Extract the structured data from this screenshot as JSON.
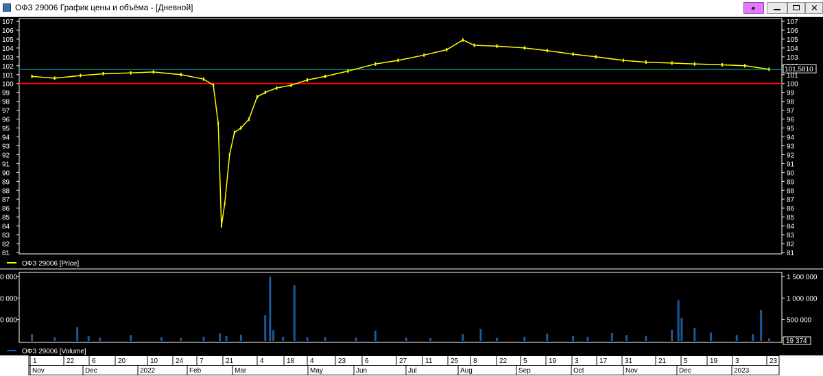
{
  "window": {
    "title": "ОФЗ 29006 График цены и объёма - [Дневной]"
  },
  "colors": {
    "price": "#ffff00",
    "volume": "#1a5a9a",
    "reference_line": "#ff0000",
    "last_price_line": "#00a0a0",
    "background": "#000000",
    "axis_text": "#ffffff"
  },
  "price_panel": {
    "legend": "ОФЗ 29006 [Price]",
    "last_value_label": "101,5810"
  },
  "volume_panel": {
    "legend": "ОФЗ 29006 [Volume]",
    "last_value_label": "19 374"
  },
  "chart_data": [
    {
      "type": "line",
      "title": "",
      "series": [
        {
          "name": "ОФЗ 29006 [Price]",
          "x": [
            "2021-11-01",
            "2021-11-15",
            "2021-12-01",
            "2021-12-15",
            "2022-01-01",
            "2022-01-15",
            "2022-02-01",
            "2022-02-15",
            "2022-02-21",
            "2022-02-24",
            "2022-02-26",
            "2022-02-28",
            "2022-03-03",
            "2022-03-06",
            "2022-03-10",
            "2022-03-15",
            "2022-03-20",
            "2022-03-25",
            "2022-04-01",
            "2022-04-10",
            "2022-04-20",
            "2022-05-01",
            "2022-05-15",
            "2022-06-01",
            "2022-06-15",
            "2022-07-01",
            "2022-07-15",
            "2022-07-25",
            "2022-08-01",
            "2022-08-15",
            "2022-09-01",
            "2022-09-15",
            "2022-10-01",
            "2022-10-15",
            "2022-11-01",
            "2022-11-15",
            "2022-12-01",
            "2022-12-15",
            "2023-01-01",
            "2023-01-15",
            "2023-01-30"
          ],
          "values": [
            100.8,
            100.6,
            100.9,
            101.1,
            101.2,
            101.3,
            101.0,
            100.5,
            99.8,
            95.5,
            84.0,
            86.5,
            92.0,
            94.5,
            95.0,
            96.0,
            98.5,
            99.0,
            99.5,
            99.8,
            100.4,
            100.8,
            101.4,
            102.2,
            102.6,
            103.2,
            103.8,
            104.9,
            104.3,
            104.2,
            104.0,
            103.7,
            103.3,
            103.0,
            102.6,
            102.4,
            102.3,
            102.2,
            102.1,
            102.0,
            101.6
          ]
        }
      ],
      "ylim": [
        81,
        107
      ],
      "y_ticks": [
        81,
        82,
        83,
        84,
        85,
        86,
        87,
        88,
        89,
        90,
        91,
        92,
        93,
        94,
        95,
        96,
        97,
        98,
        99,
        100,
        101,
        102,
        103,
        104,
        105,
        106,
        107
      ],
      "reference_line": 100,
      "last_value": 101.581,
      "grid": false,
      "legend": "bottom-left"
    },
    {
      "type": "bar",
      "title": "",
      "series": [
        {
          "name": "ОФЗ 29006 [Volume]",
          "x": [
            "2021-11-01",
            "2021-11-15",
            "2021-11-29",
            "2021-12-06",
            "2021-12-13",
            "2022-01-01",
            "2022-01-20",
            "2022-02-01",
            "2022-02-15",
            "2022-02-25",
            "2022-03-01",
            "2022-03-10",
            "2022-03-25",
            "2022-03-28",
            "2022-03-30",
            "2022-04-05",
            "2022-04-12",
            "2022-04-20",
            "2022-05-01",
            "2022-05-20",
            "2022-06-01",
            "2022-06-20",
            "2022-07-05",
            "2022-07-25",
            "2022-08-05",
            "2022-08-15",
            "2022-09-01",
            "2022-09-15",
            "2022-10-01",
            "2022-10-10",
            "2022-10-25",
            "2022-11-03",
            "2022-11-15",
            "2022-12-01",
            "2022-12-05",
            "2022-12-07",
            "2022-12-15",
            "2022-12-25",
            "2023-01-10",
            "2023-01-20",
            "2023-01-25",
            "2023-01-30"
          ],
          "values": [
            160000,
            90000,
            320000,
            110000,
            80000,
            140000,
            90000,
            70000,
            100000,
            180000,
            120000,
            150000,
            600000,
            1550000,
            250000,
            100000,
            1300000,
            90000,
            90000,
            80000,
            240000,
            80000,
            70000,
            160000,
            280000,
            80000,
            100000,
            170000,
            120000,
            100000,
            190000,
            140000,
            120000,
            260000,
            950000,
            540000,
            300000,
            200000,
            140000,
            160000,
            720000,
            60000
          ]
        }
      ],
      "ylim": [
        0,
        1500000
      ],
      "y_ticks": [
        "500 000",
        "1 000 000",
        "1 500 000"
      ],
      "left_tick_labels": [
        "0 000",
        "0 000",
        "0 000"
      ],
      "last_value": 19374,
      "legend": "bottom-left"
    }
  ],
  "time_axis": {
    "day_ticks": [
      "1",
      "22",
      "6",
      "20",
      "10",
      "24",
      "7",
      "21",
      "4",
      "18",
      "4",
      "23",
      "6",
      "27",
      "11",
      "25",
      "8",
      "22",
      "5",
      "19",
      "3",
      "17",
      "31",
      "21",
      "5",
      "19",
      "3",
      "23"
    ],
    "months": [
      "Nov",
      "Dec",
      "2022",
      "Feb",
      "Mar",
      "May",
      "Jun",
      "Jul",
      "Aug",
      "Sep",
      "Oct",
      "Nov",
      "Dec",
      "2023"
    ]
  }
}
